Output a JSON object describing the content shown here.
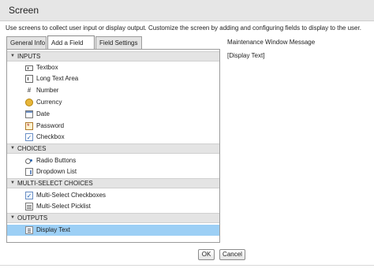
{
  "dialog": {
    "title": "Screen",
    "instructions": "Use screens to collect user input or display output. Customize the screen by adding and configuring fields to display to the user."
  },
  "tabs": [
    {
      "label": "General Info",
      "active": false
    },
    {
      "label": "Add a Field",
      "active": true
    },
    {
      "label": "Field Settings",
      "active": false
    }
  ],
  "sections": {
    "inputs": {
      "label": "INPUTS",
      "items": [
        {
          "label": "Textbox",
          "icon": "textbox-icon"
        },
        {
          "label": "Long Text Area",
          "icon": "long-text-area-icon"
        },
        {
          "label": "Number",
          "icon": "number-icon"
        },
        {
          "label": "Currency",
          "icon": "currency-icon"
        },
        {
          "label": "Date",
          "icon": "date-icon"
        },
        {
          "label": "Password",
          "icon": "password-icon"
        },
        {
          "label": "Checkbox",
          "icon": "checkbox-icon"
        }
      ]
    },
    "choices": {
      "label": "CHOICES",
      "items": [
        {
          "label": "Radio Buttons",
          "icon": "radio-buttons-icon"
        },
        {
          "label": "Dropdown List",
          "icon": "dropdown-list-icon"
        }
      ]
    },
    "multiselect": {
      "label": "MULTI-SELECT CHOICES",
      "items": [
        {
          "label": "Multi-Select Checkboxes",
          "icon": "multi-select-checkboxes-icon"
        },
        {
          "label": "Multi-Select Picklist",
          "icon": "multi-select-picklist-icon"
        }
      ]
    },
    "outputs": {
      "label": "OUTPUTS",
      "items": [
        {
          "label": "Display Text",
          "icon": "display-text-icon",
          "selected": true
        }
      ]
    }
  },
  "preview": {
    "title": "Maintenance Window Message",
    "content": "[Display Text]"
  },
  "buttons": {
    "ok": "OK",
    "cancel": "Cancel"
  },
  "icon_glyphs": {
    "number": "#",
    "check": "✓",
    "caret": "▼"
  },
  "colors": {
    "selected_row": "#9ccff5",
    "section_header": "#e4e4e4",
    "titlebar": "#e6e6e6"
  }
}
